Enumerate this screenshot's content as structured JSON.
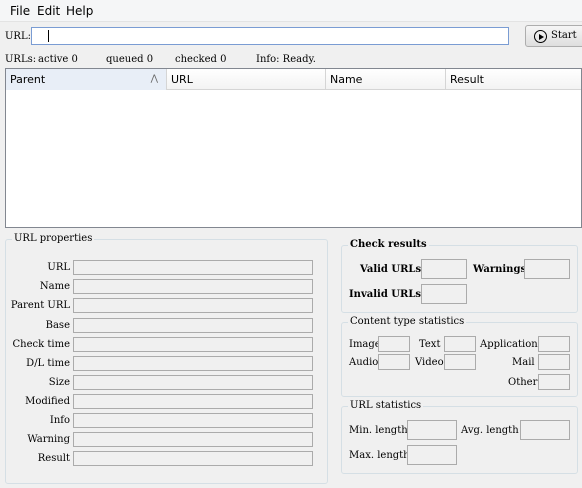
{
  "menu": [
    "File",
    "Edit",
    "Help"
  ],
  "url_row": {
    "label": "URL:",
    "value": "",
    "start_label": "Start"
  },
  "status": {
    "urls_label": "URLs:",
    "active": "active 0",
    "queued": "queued 0",
    "checked": "checked 0",
    "info": "Info: Ready."
  },
  "table": {
    "columns": [
      "Parent",
      "URL",
      "Name",
      "Result"
    ]
  },
  "url_properties": {
    "title": "URL properties",
    "labels": [
      "URL",
      "Name",
      "Parent URL",
      "Base",
      "Check time",
      "D/L time",
      "Size",
      "Modified",
      "Info",
      "Warning",
      "Result"
    ]
  },
  "check_results": {
    "title": "Check results",
    "valid": "Valid URLs",
    "warnings": "Warnings",
    "invalid": "Invalid URLs"
  },
  "content_stats": {
    "title": "Content type statistics",
    "image": "Image",
    "text": "Text",
    "application": "Application",
    "audio": "Audio",
    "video": "Video",
    "mail": "Mail",
    "other": "Other"
  },
  "url_stats": {
    "title": "URL statistics",
    "min": "Min. length",
    "avg": "Avg. length",
    "max": "Max. length"
  }
}
